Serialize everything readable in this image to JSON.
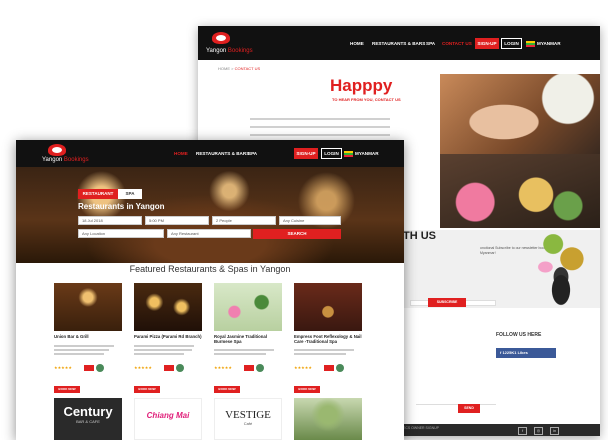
{
  "back_page": {
    "logo": {
      "name": "Yangon",
      "suffix": "Bookings"
    },
    "nav": [
      "HOME",
      "RESTAURANTS & BARS",
      "SPA",
      "CONTACT US"
    ],
    "active_nav": "CONTACT US",
    "signup": "SIGN-UP",
    "login": "LOGIN",
    "language": "MYANMAR",
    "breadcrumb": {
      "home": "HOME",
      "sep": ">",
      "current": "CONTACT US"
    },
    "hero_title": "Happpy",
    "hero_subtitle": "TO HEAR FROM YOU, CONTACT US",
    "with_us": "TH US",
    "newsletter_text": "onotional Subscribe to our newsletter bookings in Myanmar!",
    "subscribe": "SUBSCRIBE",
    "follow_title": "FOLLOW US HERE",
    "fb_likes": "1225K1 Likes",
    "send": "SEND",
    "footer_text": "ECS OWNER SIGNUP",
    "social": [
      "f",
      "◎",
      "in"
    ]
  },
  "front_page": {
    "logo": {
      "name": "Yangon",
      "suffix": "Bookings"
    },
    "nav": [
      "HOME",
      "RESTAURANTS & BARS",
      "SPA"
    ],
    "active_nav": "HOME",
    "signup": "SIGN-UP",
    "login": "LOGIN",
    "language": "MYANMAR",
    "tabs": {
      "restaurant": "RESTAURANT",
      "spa": "SPA"
    },
    "hero_heading": "Restaurants in Yangon",
    "search": {
      "date": "18 Jul 2018",
      "time": "5:00 PM",
      "people": "2 People",
      "cuisine": "Any Cuisine",
      "location": "Any Location",
      "restaurant": "Any Restaurant",
      "button": "SEARCH"
    },
    "section_title": "Featured Restaurants & Spas in Yangon",
    "cards": [
      {
        "name": "Union Bar & Grill",
        "book": "BOOK NOW"
      },
      {
        "name": "Parami Pizza (Parami Rd Branch)",
        "book": "BOOK NOW"
      },
      {
        "name": "Royal Jasmine Traditional Burmese Spa",
        "book": "BOOK NOW"
      },
      {
        "name": "Empress Foot Reflexology & Nail Care -Traditional Spa",
        "book": "BOOK NOW"
      }
    ],
    "row2": [
      {
        "brand": "Century",
        "sub": "BAR & CAFE"
      },
      {
        "brand": "Chiang Mai",
        "sub": ""
      },
      {
        "brand": "VESTIGE",
        "sub": "Café"
      },
      {
        "brand": "",
        "sub": ""
      }
    ],
    "colors": {
      "accent": "#e02020",
      "nav_bg": "#111111"
    }
  }
}
